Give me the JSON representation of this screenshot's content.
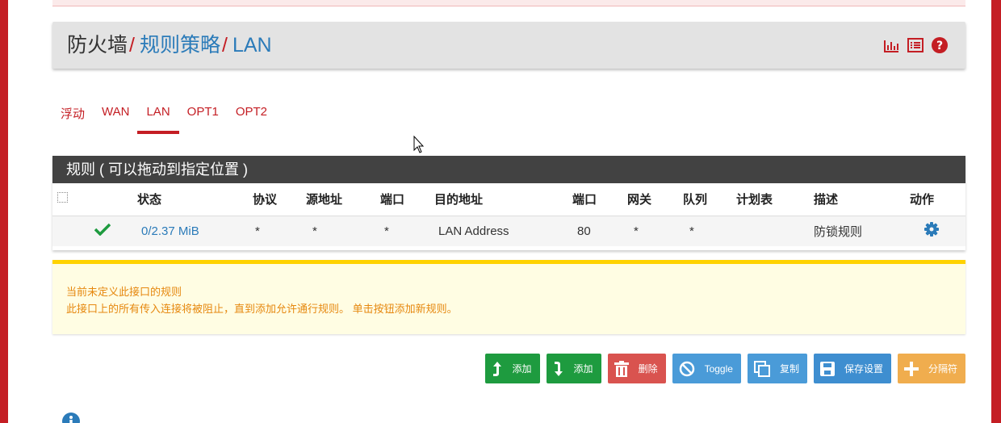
{
  "breadcrumb": {
    "root": "防火墙",
    "separator": "/",
    "level2": "规则策略",
    "level3": "LAN"
  },
  "header_icons": [
    "chart-icon",
    "list-icon",
    "help-icon"
  ],
  "tabs": [
    "浮动",
    "WAN",
    "LAN",
    "OPT1",
    "OPT2"
  ],
  "active_tab": "LAN",
  "rules": {
    "title": "规则 ( 可以拖动到指定位置 )",
    "columns": [
      "状态",
      "协议",
      "源地址",
      "端口",
      "目的地址",
      "端口",
      "网关",
      "队列",
      "计划表",
      "描述",
      "动作"
    ],
    "rows": [
      {
        "status": "0/2.37 MiB",
        "protocol": "*",
        "source": "*",
        "src_port": "*",
        "destination": "LAN Address",
        "dst_port": "80",
        "gateway": "*",
        "queue": "*",
        "schedule": "",
        "description": "防锁规则"
      }
    ]
  },
  "warning": {
    "line1": "当前未定义此接口的规则",
    "line2": "此接口上的所有传入连接将被阻止，直到添加允许通行规则。 单击按钮添加新规则。"
  },
  "buttons": {
    "add_top": "添加",
    "add_bottom": "添加",
    "delete": "删除",
    "toggle": "Toggle",
    "copy": "复制",
    "save": "保存设置",
    "separator": "分隔符"
  },
  "colors": {
    "brand_red": "#c41e24",
    "link_blue": "#2b7bb9",
    "success_green": "#1e9b3f",
    "warning_orange": "#e6880f",
    "header_dark": "#424242"
  }
}
